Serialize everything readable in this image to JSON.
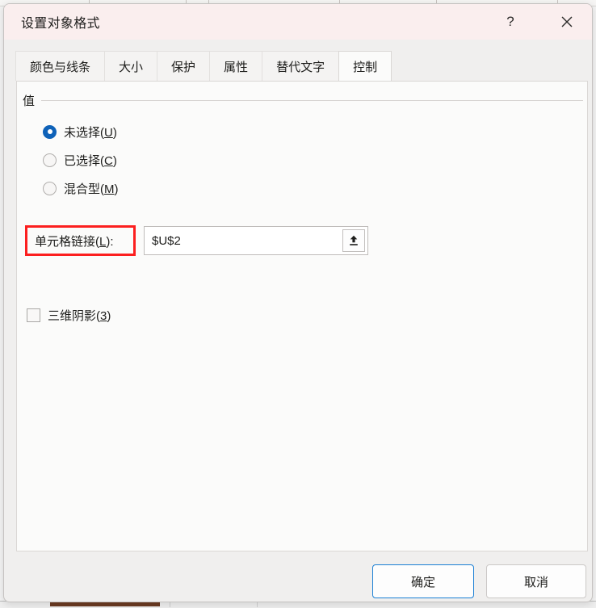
{
  "window": {
    "title": "设置对象格式",
    "help_icon": "question-mark-icon",
    "help_glyph": "?",
    "close_icon": "close-icon",
    "titlebar_color": "#faeeee"
  },
  "tabs": [
    {
      "label": "颜色与线条",
      "selected": false
    },
    {
      "label": "大小",
      "selected": false
    },
    {
      "label": "保护",
      "selected": false
    },
    {
      "label": "属性",
      "selected": false
    },
    {
      "label": "替代文字",
      "selected": false
    },
    {
      "label": "控制",
      "selected": true
    }
  ],
  "control_tab": {
    "value_group": {
      "legend": "值",
      "options": [
        {
          "label_main": "未选择",
          "accesskey": "U",
          "selected": true
        },
        {
          "label_main": "已选择",
          "accesskey": "C",
          "selected": false
        },
        {
          "label_main": "混合型",
          "accesskey": "M",
          "selected": false
        }
      ]
    },
    "cell_link": {
      "label_main": "单元格链接",
      "label_accesskey": "L",
      "label_suffix": ":",
      "value": "$U$2",
      "placeholder": "",
      "picker_icon": "range-selector-up-arrow-icon",
      "highlight_color": "#fc1f1f"
    },
    "shadow": {
      "label_main": "三维阴影",
      "accesskey": "3",
      "checked": false
    }
  },
  "footer": {
    "ok_label": "确定",
    "cancel_label": "取消",
    "accent_color": "#1a7fd4"
  }
}
